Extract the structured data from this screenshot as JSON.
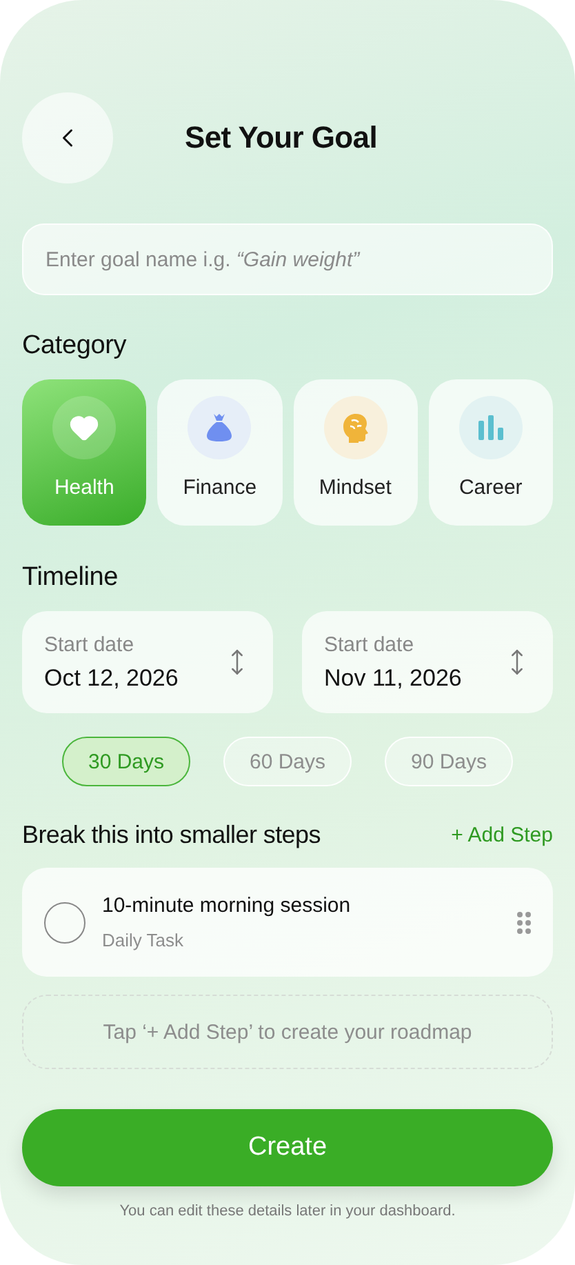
{
  "header": {
    "title": "Set Your Goal"
  },
  "goal_field": {
    "placeholder": "Enter goal name i.g. *“Gain weight”*"
  },
  "category": {
    "title": "Category",
    "items": [
      {
        "label": "Health",
        "kind": "heart",
        "color": "#ffffff",
        "selected": true
      },
      {
        "label": "Finance",
        "kind": "bag",
        "color": "#6f8ff0",
        "selected": false
      },
      {
        "label": "Mindset",
        "kind": "head",
        "color": "#f0b43a",
        "selected": false
      },
      {
        "label": "Career",
        "kind": "bars",
        "color": "#5bbfcf",
        "selected": false
      }
    ]
  },
  "timeline": {
    "title": "Timeline",
    "dates": [
      {
        "label": "Start date",
        "value": "Oct 12, 2026"
      },
      {
        "label": "Start date",
        "value": "Nov 11, 2026"
      }
    ],
    "durations": [
      {
        "label": "30 Days",
        "selected": true
      },
      {
        "label": "60 Days",
        "selected": false
      },
      {
        "label": "90 Days",
        "selected": false
      }
    ]
  },
  "steps": {
    "title": "Break this into smaller steps",
    "add_label": "+ Add Step",
    "items": [
      {
        "title": "10-minute morning session",
        "subtitle": "Daily Task",
        "checked": false
      }
    ],
    "hint": "Tap ‘+ Add Step’ to create your roadmap"
  },
  "create_button": "Create",
  "footer_note": "You can edit these details later in your dashboard."
}
